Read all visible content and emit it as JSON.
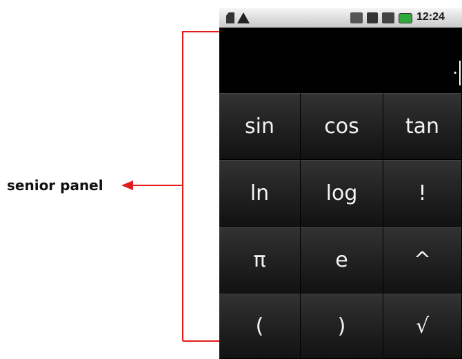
{
  "annotation": {
    "label": "senior panel"
  },
  "status_bar": {
    "time": "12:24",
    "icons": [
      "sd-card-icon",
      "warning-icon",
      "mute-icon",
      "sync-icon",
      "signal-icon",
      "battery-icon"
    ]
  },
  "display": {
    "value": "."
  },
  "keypad": {
    "keys": [
      "sin",
      "cos",
      "tan",
      "ln",
      "log",
      "!",
      "π",
      "e",
      "^",
      "(",
      ")",
      "√"
    ]
  },
  "colors": {
    "annotation": "#e41b1b",
    "key_text": "#f3f3f3",
    "battery": "#2ea83a"
  }
}
